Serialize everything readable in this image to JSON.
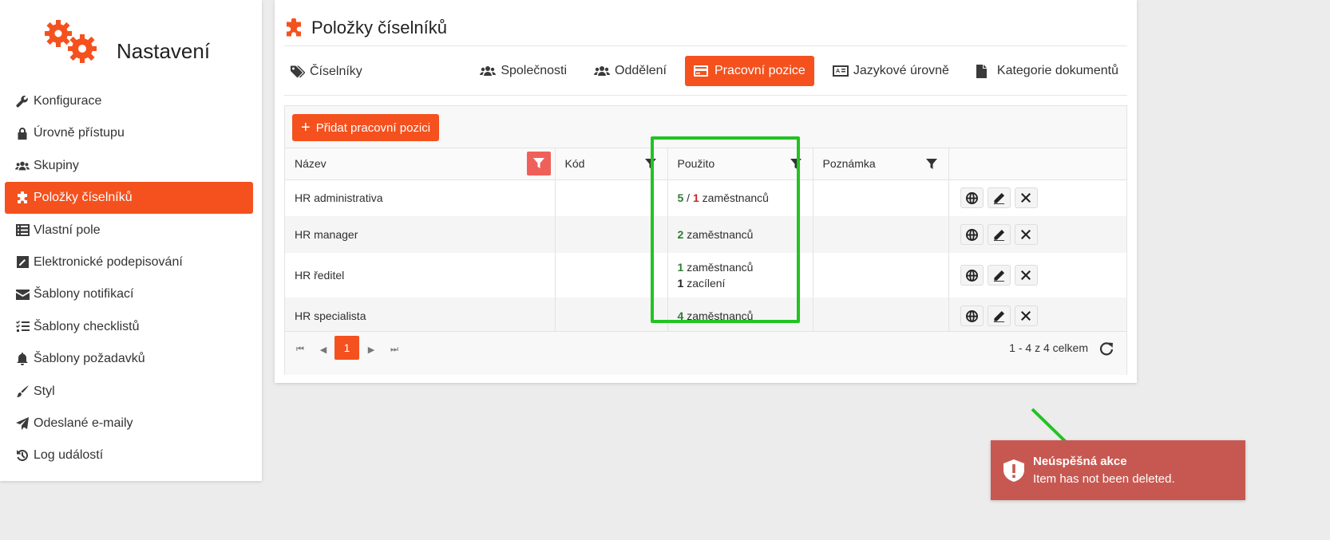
{
  "sidebar": {
    "title": "Nastavení",
    "items": [
      {
        "label": "Konfigurace",
        "icon": "wrench-icon"
      },
      {
        "label": "Úrovně přístupu",
        "icon": "lock-icon"
      },
      {
        "label": "Skupiny",
        "icon": "users-icon"
      },
      {
        "label": "Položky číselníků",
        "icon": "puzzle-icon"
      },
      {
        "label": "Vlastní pole",
        "icon": "list-icon"
      },
      {
        "label": "Elektronické podepisování",
        "icon": "signature-icon"
      },
      {
        "label": "Šablony notifikací",
        "icon": "envelope-icon"
      },
      {
        "label": "Šablony checklistů",
        "icon": "checklist-icon"
      },
      {
        "label": "Šablony požadavků",
        "icon": "bell-icon"
      },
      {
        "label": "Styl",
        "icon": "brush-icon"
      },
      {
        "label": "Odeslané e-maily",
        "icon": "paper-plane-icon"
      },
      {
        "label": "Log událostí",
        "icon": "history-icon"
      }
    ],
    "active_index": 3
  },
  "page": {
    "title": "Položky číselníků",
    "left_tab": "Číselníky",
    "tabs": [
      "Společnosti",
      "Oddělení",
      "Pracovní pozice",
      "Jazykové úrovně",
      "Kategorie dokumentů"
    ],
    "active_tab": "Pracovní pozice"
  },
  "grid": {
    "add_button": "Přidat pracovní pozici",
    "columns": [
      "Název",
      "Kód",
      "Použito",
      "Poznámka"
    ],
    "rows": [
      {
        "name": "HR administrativa",
        "code": "",
        "used_a": "5",
        "used_sep": " / ",
        "used_b": "1",
        "used_label": "zaměstnanců",
        "note": ""
      },
      {
        "name": "HR manager",
        "code": "",
        "used_a": "2",
        "used_label": "zaměstnanců",
        "note": ""
      },
      {
        "name": "HR ředitel",
        "code": "",
        "used_a": "1",
        "used_label": "zaměstnanců",
        "used_c": "1",
        "used_label2": "zacílení",
        "note": ""
      },
      {
        "name": "HR specialista",
        "code": "",
        "used_a": "4",
        "used_label": "zaměstnanců",
        "note": ""
      }
    ],
    "pager": {
      "current_page": "1",
      "info": "1 - 4 z 4 celkem"
    }
  },
  "toast": {
    "title": "Neúspěšná akce",
    "message": "Item has not been deleted."
  },
  "colors": {
    "accent": "#f4511e",
    "toast": "#c75851",
    "highlight": "#22c322"
  }
}
